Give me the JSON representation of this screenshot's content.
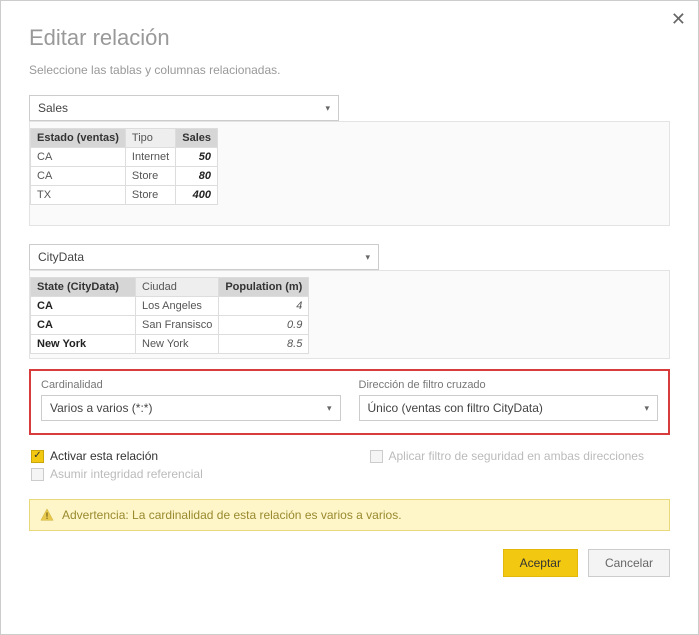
{
  "dialog": {
    "title": "Editar relación",
    "subtitle": "Seleccione las tablas y columnas relacionadas.",
    "close": "✕"
  },
  "table1": {
    "selected": "Sales",
    "headers": {
      "c0": "Estado (ventas)",
      "c1": "Tipo",
      "c2": "Sales"
    },
    "rows": [
      {
        "c0": "CA",
        "c1": "Internet",
        "c2": "50"
      },
      {
        "c0": "CA",
        "c1": "Store",
        "c2": "80"
      },
      {
        "c0": "TX",
        "c1": "Store",
        "c2": "400"
      }
    ]
  },
  "table2": {
    "selected": "CityData",
    "headers": {
      "c0": "State (CityData)",
      "c1": "Ciudad",
      "c2": "Population (m)"
    },
    "rows": [
      {
        "c0": "CA",
        "c1": "Los Angeles",
        "c2": "4"
      },
      {
        "c0": "CA",
        "c1": "San Fransisco",
        "c2": "0.9"
      },
      {
        "c0": "New York",
        "c1": "New York",
        "c2": "8.5"
      }
    ]
  },
  "cardinality": {
    "label": "Cardinalidad",
    "value": "Varios a varios (*:*)"
  },
  "crossfilter": {
    "label": "Dirección de filtro cruzado",
    "value": "Único (ventas con filtro CityData)"
  },
  "checks": {
    "activate": "Activar esta relación",
    "security": "Aplicar filtro de seguridad en ambas direcciones",
    "referential": "Asumir integridad referencial"
  },
  "warning": "Advertencia: La cardinalidad de esta relación es varios a varios.",
  "buttons": {
    "ok": "Aceptar",
    "cancel": "Cancelar"
  },
  "chart_data": null
}
